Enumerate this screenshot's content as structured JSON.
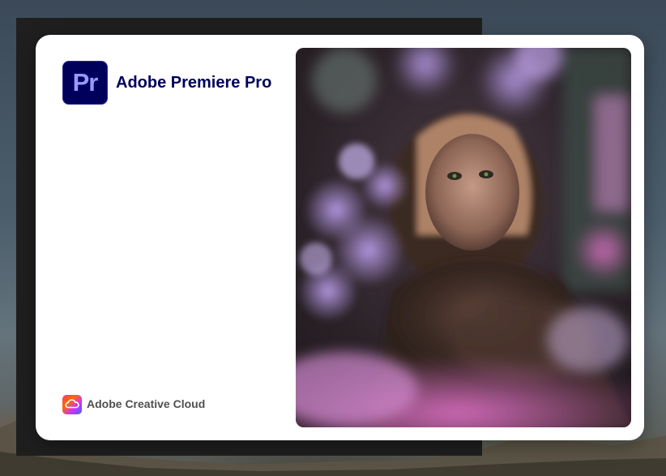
{
  "splash": {
    "app_icon_text": "Pr",
    "app_name": "Adobe Premiere Pro",
    "footer_label": "Adobe Creative Cloud"
  },
  "colors": {
    "app_icon_bg": "#00005b",
    "app_icon_fg": "#9999ff",
    "title": "#00005b",
    "footer_text": "#505050"
  },
  "icons": {
    "app": "premiere-pro-icon",
    "footer": "creative-cloud-icon"
  }
}
